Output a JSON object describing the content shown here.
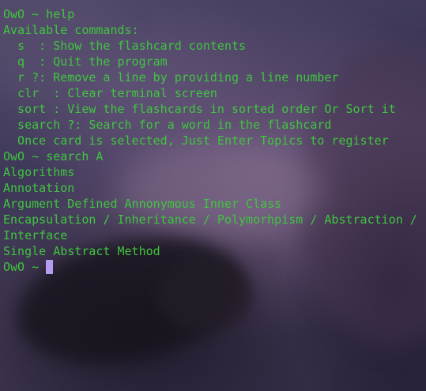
{
  "terminal": {
    "prompt": "OwO ~ ",
    "colors": {
      "text": "#3fc63f",
      "cursor": "#b59cf2"
    },
    "session": [
      {
        "kind": "prompt",
        "command": "help"
      },
      {
        "kind": "output",
        "text": "Available commands:"
      },
      {
        "kind": "output",
        "text": "  s  : Show the flashcard contents"
      },
      {
        "kind": "output",
        "text": "  q  : Quit the program"
      },
      {
        "kind": "output",
        "text": "  r ?: Remove a line by providing a line number"
      },
      {
        "kind": "output",
        "text": "  clr  : Clear terminal screen"
      },
      {
        "kind": "output",
        "text": "  sort : View the flashcards in sorted order Or Sort it"
      },
      {
        "kind": "output",
        "text": "  search ?: Search for a word in the flashcard"
      },
      {
        "kind": "output",
        "text": "  Once card is selected, Just Enter Topics to register"
      },
      {
        "kind": "prompt",
        "command": "search A"
      },
      {
        "kind": "output",
        "text": "Algorithms"
      },
      {
        "kind": "output",
        "text": "Annotation"
      },
      {
        "kind": "output",
        "text": "Argument Defined Annonymous Inner Class"
      },
      {
        "kind": "output",
        "text": "Encapsulation / Inheritance / Polymorhpism / Abstraction /"
      },
      {
        "kind": "output",
        "text": "Interface"
      },
      {
        "kind": "output",
        "text": "Single Abstract Method"
      }
    ],
    "current_input": ""
  }
}
